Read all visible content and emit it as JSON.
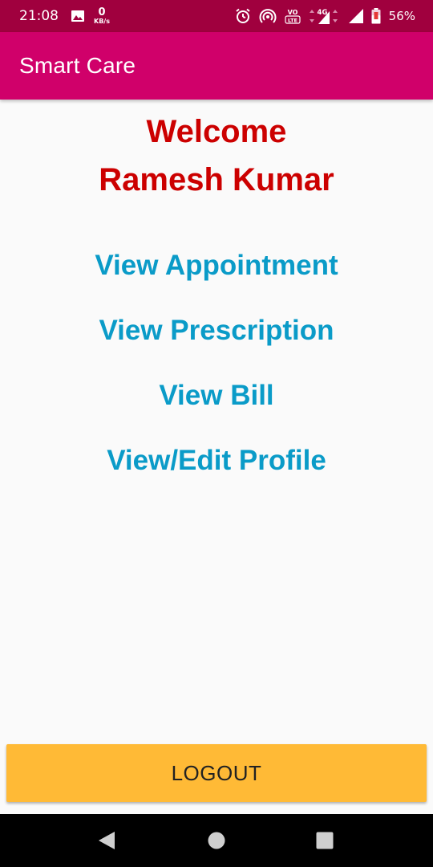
{
  "status_bar": {
    "time": "21:08",
    "data_rate_value": "0",
    "data_rate_unit": "KB/s",
    "volte_label": "VO LTE",
    "network_label": "4G",
    "battery_percent": "56%",
    "icons": [
      "gallery-icon",
      "alarm-icon",
      "hotspot-icon",
      "volte-icon",
      "signal-icon",
      "battery-icon"
    ]
  },
  "app_bar": {
    "title": "Smart Care",
    "color": "#D0006A"
  },
  "welcome": {
    "line1": "Welcome",
    "line2": "Ramesh Kumar",
    "color": "#CC0000"
  },
  "menu": {
    "color": "#0A9BC8",
    "items": [
      {
        "label": "View Appointment"
      },
      {
        "label": "View Prescription"
      },
      {
        "label": "View Bill"
      },
      {
        "label": "View/Edit Profile"
      }
    ]
  },
  "logout": {
    "label": "LOGOUT",
    "color": "#FFBA36"
  },
  "nav_bar": {
    "icons": [
      "back-icon",
      "home-icon",
      "recents-icon"
    ]
  }
}
